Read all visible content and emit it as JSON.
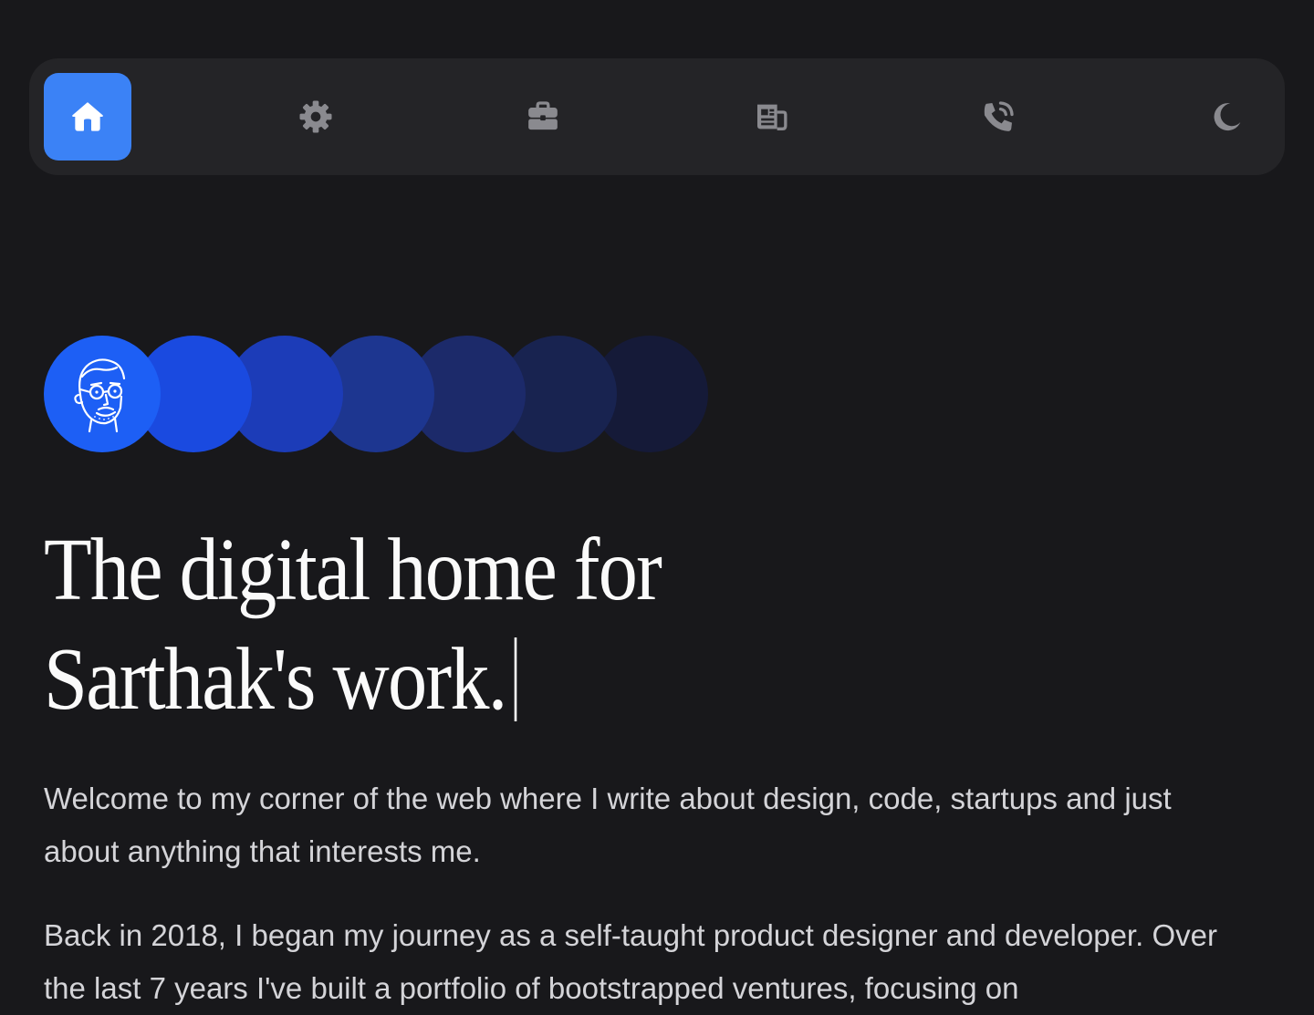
{
  "nav": {
    "items": [
      {
        "icon": "home-icon",
        "active": true
      },
      {
        "icon": "gear-icon",
        "active": false
      },
      {
        "icon": "briefcase-icon",
        "active": false
      },
      {
        "icon": "newspaper-icon",
        "active": false
      },
      {
        "icon": "phone-call-icon",
        "active": false
      },
      {
        "icon": "moon-icon",
        "active": false
      }
    ],
    "active_color": "#3b82f6",
    "icon_color": "#8a8a8f"
  },
  "hero": {
    "title_line1": "The digital home for",
    "title_line2": "Sarthak's work.",
    "paragraph1": "Welcome to my corner of the web where I write about design, code, startups and just about anything that interests me.",
    "paragraph2": "Back in 2018, I began my journey as a self-taught product designer and developer. Over the last 7 years I've built a portfolio of bootstrapped ventures, focusing on"
  },
  "colors": {
    "background": "#18181b",
    "navbar": "#242427",
    "avatar_bg": "#1d5ff5",
    "circle_gradient": [
      "#1a4ae0",
      "#1c3cb8",
      "#1d3690",
      "#1c2a6a",
      "#182350",
      "#151a38"
    ]
  }
}
